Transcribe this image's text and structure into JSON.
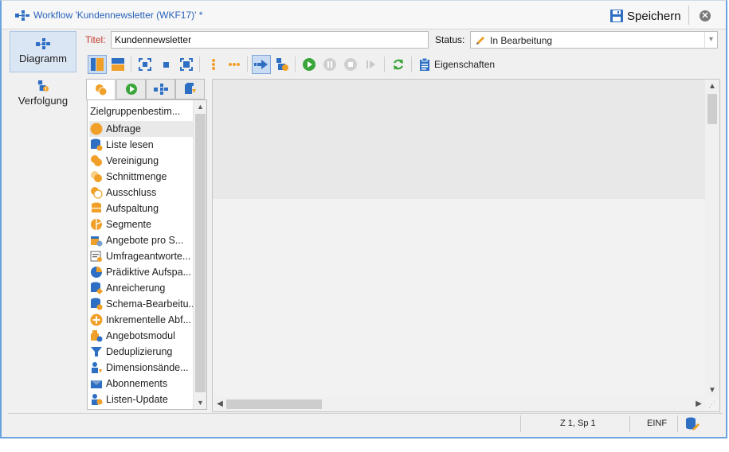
{
  "window": {
    "title": "Workflow 'Kundennewsletter (WKF17)' *",
    "save_label": "Speichern",
    "close_icon": "close-icon"
  },
  "nav": {
    "items": [
      {
        "label": "Diagramm",
        "icon": "diagram-icon",
        "active": true
      },
      {
        "label": "Verfolgung",
        "icon": "tracking-icon",
        "active": false
      }
    ]
  },
  "form": {
    "title_label": "Titel:",
    "title_value": "Kundennewsletter",
    "status_label": "Status:",
    "status_value": "In Bearbeitung"
  },
  "toolbar": {
    "properties_label": "Eigenschaften"
  },
  "palette": {
    "header": "Zielgruppenbestim...",
    "items": [
      {
        "label": "Abfrage",
        "icon": "query-icon"
      },
      {
        "label": "Liste lesen",
        "icon": "read-list-icon"
      },
      {
        "label": "Vereinigung",
        "icon": "union-icon"
      },
      {
        "label": "Schnittmenge",
        "icon": "intersection-icon"
      },
      {
        "label": "Ausschluss",
        "icon": "exclusion-icon"
      },
      {
        "label": "Aufspaltung",
        "icon": "split-icon"
      },
      {
        "label": "Segmente",
        "icon": "segments-icon"
      },
      {
        "label": "Angebote pro S...",
        "icon": "offers-icon"
      },
      {
        "label": "Umfrageantworte...",
        "icon": "survey-icon"
      },
      {
        "label": "Prädiktive Aufspa...",
        "icon": "predictive-icon"
      },
      {
        "label": "Anreicherung",
        "icon": "enrichment-icon"
      },
      {
        "label": "Schema-Bearbeitu...",
        "icon": "schema-icon"
      },
      {
        "label": "Inkrementelle Abf...",
        "icon": "incremental-icon"
      },
      {
        "label": "Angebotsmodul",
        "icon": "offer-engine-icon"
      },
      {
        "label": "Deduplizierung",
        "icon": "dedup-icon"
      },
      {
        "label": "Dimensionsände...",
        "icon": "dimension-icon"
      },
      {
        "label": "Abonnements",
        "icon": "subscriptions-icon"
      },
      {
        "label": "Listen-Update",
        "icon": "list-update-icon"
      }
    ]
  },
  "statusbar": {
    "position": "Z 1, Sp 1",
    "mode": "EINF"
  },
  "colors": {
    "accent": "#2a62b8",
    "orange": "#f0a028",
    "green": "#3aa53a",
    "blue": "#2e6fc4"
  }
}
